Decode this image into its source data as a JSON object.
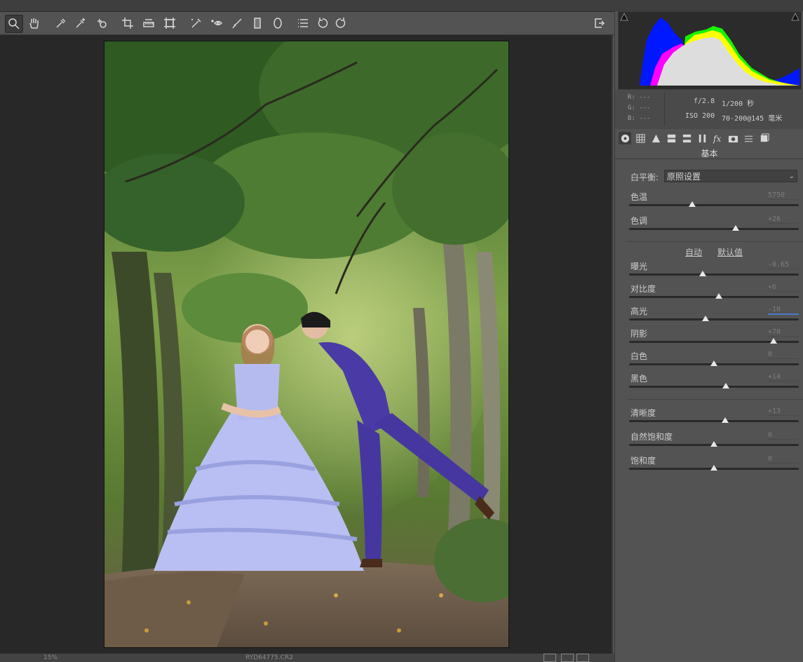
{
  "statusbar": {
    "zoom": "15%",
    "filename": "RYD64775.CR2"
  },
  "histogram": {
    "colors": [
      "#0018ff",
      "#ff00ff",
      "#ffff00",
      "#ddddde",
      "#17f400"
    ]
  },
  "readout": {
    "r": "R:  ---",
    "g": "G:  ---",
    "b": "B:  ---",
    "aperture": "f/2.8",
    "shutter": "1/200 秒",
    "iso": "ISO 200",
    "lens": "70-200@145 毫米"
  },
  "panel": {
    "title": "基本",
    "wb_label": "白平衡:",
    "wb_value": "原照设置",
    "auto_link": "自动",
    "default_link": "默认值",
    "sliders": [
      {
        "label": "色温",
        "value": "5750",
        "level": 0.37
      },
      {
        "label": "色调",
        "value": "+26",
        "level": 0.63
      },
      {
        "label": "曝光",
        "value": "-0.65",
        "level": 0.435
      },
      {
        "label": "对比度",
        "value": "+6",
        "level": 0.53
      },
      {
        "label": "高光",
        "value": "-10",
        "level": 0.45
      },
      {
        "label": "阴影",
        "value": "+70",
        "level": 0.85
      },
      {
        "label": "白色",
        "value": "0",
        "level": 0.5
      },
      {
        "label": "黑色",
        "value": "+14",
        "level": 0.57
      },
      {
        "label": "清晰度",
        "value": "+13",
        "level": 0.565
      },
      {
        "label": "自然饱和度",
        "value": "0",
        "level": 0.5
      },
      {
        "label": "饱和度",
        "value": "0",
        "level": 0.5
      }
    ]
  },
  "icons": {
    "toolbar": [
      "zoom-tool-icon",
      "hand-tool-icon",
      "white-balance-tool-icon",
      "color-sampler-icon",
      "targeted-adjustment-icon",
      "crop-tool-icon",
      "straighten-tool-icon",
      "transform-tool-icon",
      "spot-removal-icon",
      "red-eye-icon",
      "adjustment-brush-icon",
      "graduated-filter-icon",
      "radial-filter-icon",
      "preferences-icon",
      "rotate-left-icon",
      "rotate-right-icon",
      "fullscreen-icon"
    ],
    "tabs": [
      "basic-tab-icon",
      "tone-curve-tab-icon",
      "detail-tab-icon",
      "hsl-tab-icon",
      "split-toning-tab-icon",
      "lens-tab-icon",
      "effects-tab-icon",
      "camera-calibration-tab-icon",
      "presets-tab-icon",
      "snapshots-tab-icon"
    ]
  }
}
